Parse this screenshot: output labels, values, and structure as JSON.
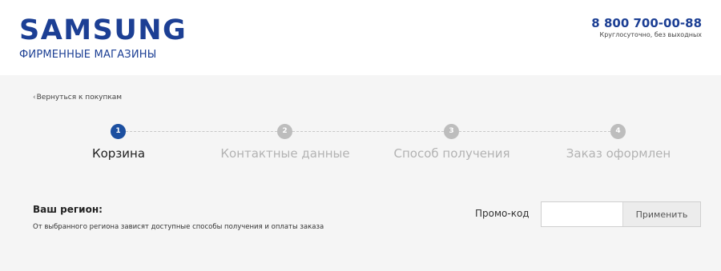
{
  "header": {
    "logo_wordmark": "SAMSUNG",
    "logo_subtitle": "ФИРМЕННЫЕ МАГАЗИНЫ",
    "phone": "8 800 700-00-88",
    "phone_note": "Круглосуточно, без выходных"
  },
  "nav": {
    "back_link": "Вернуться к покупкам"
  },
  "steps": [
    {
      "number": "1",
      "label": "Корзина",
      "state": "active"
    },
    {
      "number": "2",
      "label": "Контактные данные",
      "state": "inactive"
    },
    {
      "number": "3",
      "label": "Способ получения",
      "state": "inactive"
    },
    {
      "number": "4",
      "label": "Заказ оформлен",
      "state": "inactive"
    }
  ],
  "region": {
    "title": "Ваш регион:",
    "description": "От выбранного региона зависят доступные способы получения и оплаты заказа"
  },
  "promo": {
    "label": "Промо-код",
    "input_value": "",
    "input_placeholder": "",
    "apply_label": "Применить"
  },
  "colors": {
    "brand_blue": "#1c3f94",
    "active_step": "#1c4fa0",
    "inactive_step": "#bdbdbd",
    "content_bg": "#f5f5f5"
  },
  "icons": {
    "back": "chevron-left-icon"
  }
}
